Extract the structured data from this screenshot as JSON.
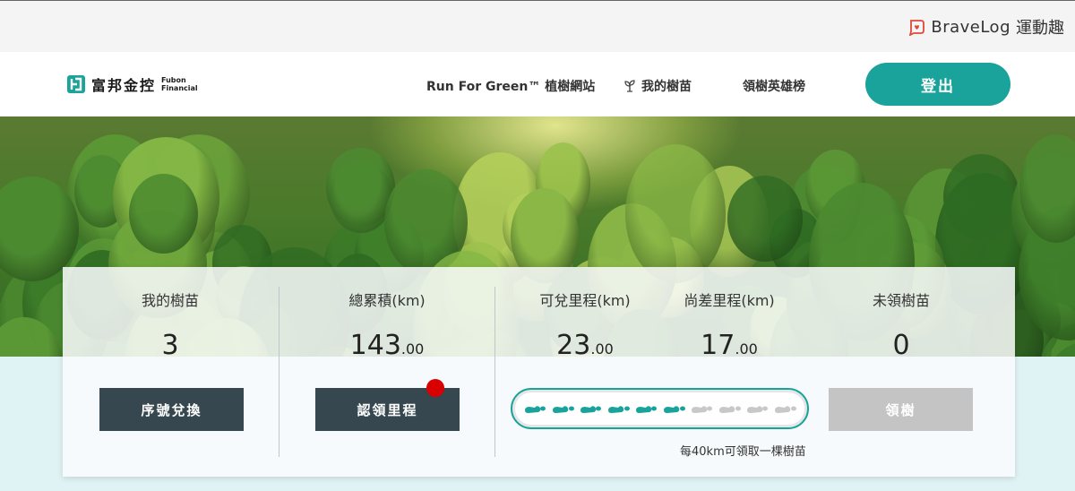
{
  "topbar": {
    "brand_name": "BraveLog",
    "brand_cn": "運動趣"
  },
  "header": {
    "logo_cn": "富邦金控",
    "logo_en_line1": "Fubon",
    "logo_en_line2": "Financial",
    "nav": [
      {
        "label": "Run For Green™ 植樹網站"
      },
      {
        "label": "我的樹苗",
        "icon": "sprout-icon"
      },
      {
        "label": "領樹英雄榜"
      }
    ],
    "logout_label": "登出"
  },
  "stats": {
    "my_seedlings": {
      "label": "我的樹苗",
      "value": "3",
      "button": "序號兌換"
    },
    "total": {
      "label": "總累積(km)",
      "value_int": "143",
      "value_dec": ".00",
      "button": "認領里程"
    },
    "redeemable": {
      "label": "可兌里程(km)",
      "value_int": "23",
      "value_dec": ".00"
    },
    "remaining": {
      "label": "尚差里程(km)",
      "value_int": "17",
      "value_dec": ".00"
    },
    "unclaimed": {
      "label": "未領樹苗",
      "value": "0",
      "button": "領樹"
    },
    "progress": {
      "filled_steps": 6,
      "total_steps": 10,
      "note": "每40km可領取一棵樹苗"
    }
  },
  "colors": {
    "accent": "#1aa39a",
    "dark_button": "#36474f",
    "disabled_button": "#c4c4c4",
    "notice_dot": "#d80000"
  }
}
